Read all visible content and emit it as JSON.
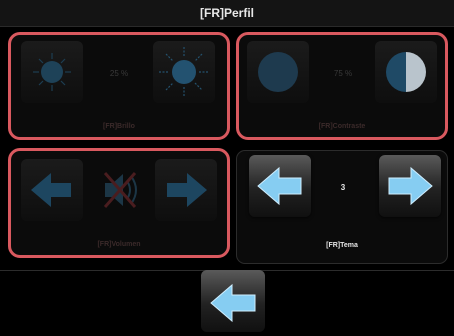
{
  "header": {
    "title": "[FR]Perfil"
  },
  "brightness": {
    "label": "[FR]Brillo",
    "value": "25 %",
    "decrease_icon": "sun-dim-icon",
    "increase_icon": "sun-bright-icon"
  },
  "contrast": {
    "label": "[FR]Contraste",
    "value": "75 %",
    "decrease_icon": "contrast-low-icon",
    "increase_icon": "contrast-high-icon"
  },
  "volume": {
    "label": "[FR]Volumen",
    "decrease_icon": "arrow-left-icon",
    "status_icon": "speaker-muted-icon",
    "increase_icon": "arrow-right-icon"
  },
  "theme": {
    "label": "[FR]Tema",
    "value": "3",
    "decrease_icon": "arrow-left-icon",
    "increase_icon": "arrow-right-icon"
  },
  "footer": {
    "back_icon": "arrow-left-icon"
  },
  "colors": {
    "selection_border": "#d9595f",
    "arrow_blue": "#7fc8ee",
    "background": "#000000"
  }
}
